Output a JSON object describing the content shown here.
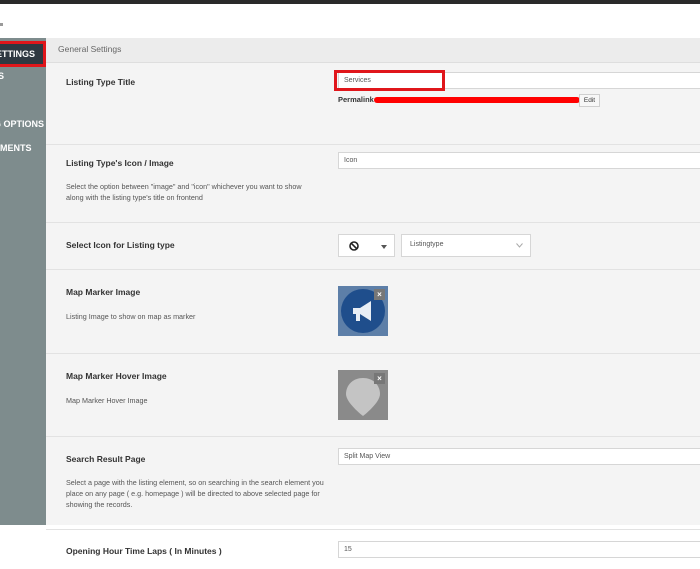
{
  "sidebar": {
    "items": [
      {
        "label": "SETTINGS"
      },
      {
        "label": "S"
      },
      {
        "label": "G OPTIONS"
      },
      {
        "label": "EMENTS"
      }
    ]
  },
  "section": {
    "title": "General Settings"
  },
  "listing_type_title": {
    "label": "Listing Type Title",
    "value": "Services",
    "permalink_label": "Permalink:",
    "edit_label": "Edit"
  },
  "icon_image": {
    "label": "Listing Type's Icon / Image",
    "description": "Select the option between \"image\" and \"icon\" whichever you want to show along with the listing type's title on frontend",
    "value": "Icon"
  },
  "select_icon": {
    "label": "Select Icon for Listing type",
    "icon_name": "ban-icon",
    "value": "Listingtype"
  },
  "map_marker": {
    "label": "Map Marker Image",
    "description": "Listing Image to show on map as marker",
    "remove_label": "×"
  },
  "map_marker_hover": {
    "label": "Map Marker Hover Image",
    "description": "Map Marker Hover Image",
    "remove_label": "×"
  },
  "search_result_page": {
    "label": "Search Result Page",
    "description": "Select a page with the listing element, so on searching in the search element you place on any page ( e.g. homepage ) will be directed to above selected page for showing the records.",
    "value": "Split Map View"
  },
  "opening_hour": {
    "label": "Opening Hour Time Laps ( In Minutes )",
    "value": "15"
  },
  "colors": {
    "sidebar": "#7e8c8d",
    "sidebar_active": "#2f3942",
    "highlight": "#e0161b",
    "marker_blue": "#1f4e8c"
  }
}
